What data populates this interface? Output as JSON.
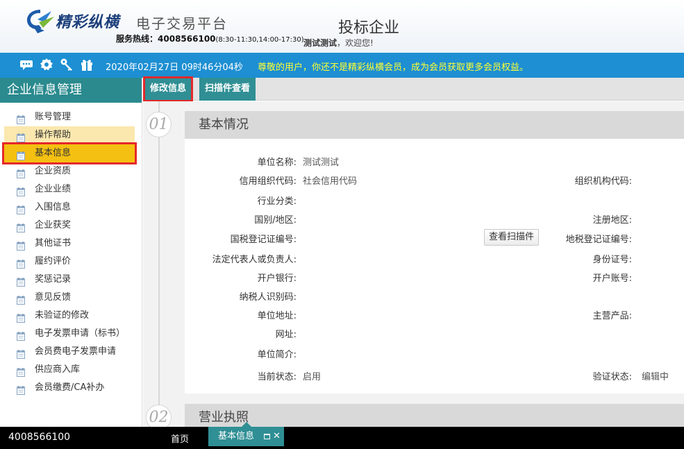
{
  "header": {
    "brand": "精彩纵横",
    "brand_sub": "电子交易平台",
    "hotline_label": "服务热线：",
    "hotline_number": "4008566100",
    "hotline_hours": "(8:30-11:30,14:00-17:30)",
    "page_title": "投标企业",
    "welcome_user": "测试测试",
    "welcome_text": "，欢迎您!"
  },
  "toolbar": {
    "icons": [
      "message-icon",
      "settings-icon",
      "key-icon",
      "gift-icon"
    ],
    "datetime": "2020年02月27日 09时46分04秒",
    "notice": "尊敬的用户，你还不是精彩纵横会员，成为会员获取更多会员权益。"
  },
  "sidebar": {
    "title": "企业信息管理",
    "items": [
      {
        "label": "账号管理"
      },
      {
        "label": "操作帮助"
      },
      {
        "label": "基本信息"
      },
      {
        "label": "企业资质"
      },
      {
        "label": "企业业绩"
      },
      {
        "label": "入围信息"
      },
      {
        "label": "企业获奖"
      },
      {
        "label": "其他证书"
      },
      {
        "label": "履约评价"
      },
      {
        "label": "奖惩记录"
      },
      {
        "label": "意见反馈"
      },
      {
        "label": "未验证的修改"
      },
      {
        "label": "电子发票申请（标书）"
      },
      {
        "label": "会员费电子发票申请"
      },
      {
        "label": "供应商入库"
      },
      {
        "label": "会员缴费/CA补办"
      }
    ]
  },
  "tabs": {
    "edit": "修改信息",
    "scan": "扫描件查看"
  },
  "section1": {
    "num": "01",
    "title": "基本情况",
    "unit_name_label": "单位名称:",
    "unit_name_value": "测试测试",
    "credit_code_label": "信用组织代码:",
    "credit_code_value": "社会信用代码",
    "org_code_label": "组织机构代码:",
    "industry_label": "行业分类:",
    "country_label": "国别/地区:",
    "reg_area_label": "注册地区:",
    "national_tax_label": "国税登记证编号:",
    "view_scan_button": "查看扫描件",
    "local_tax_label": "地税登记证编号:",
    "legal_rep_label": "法定代表人或负责人:",
    "id_number_label": "身份证号:",
    "bank_label": "开户银行:",
    "account_label": "开户账号:",
    "taxpayer_label": "纳税人识别码:",
    "address_label": "单位地址:",
    "main_product_label": "主营产品:",
    "website_label": "网址:",
    "intro_label": "单位简介:",
    "status_label": "当前状态:",
    "status_value": "启用",
    "verify_label": "验证状态:",
    "verify_value": "编辑中"
  },
  "section2": {
    "num": "02",
    "title": "营业执照"
  },
  "footer": {
    "phone": "4008566100",
    "home": "首页",
    "open_tab": "基本信息"
  }
}
